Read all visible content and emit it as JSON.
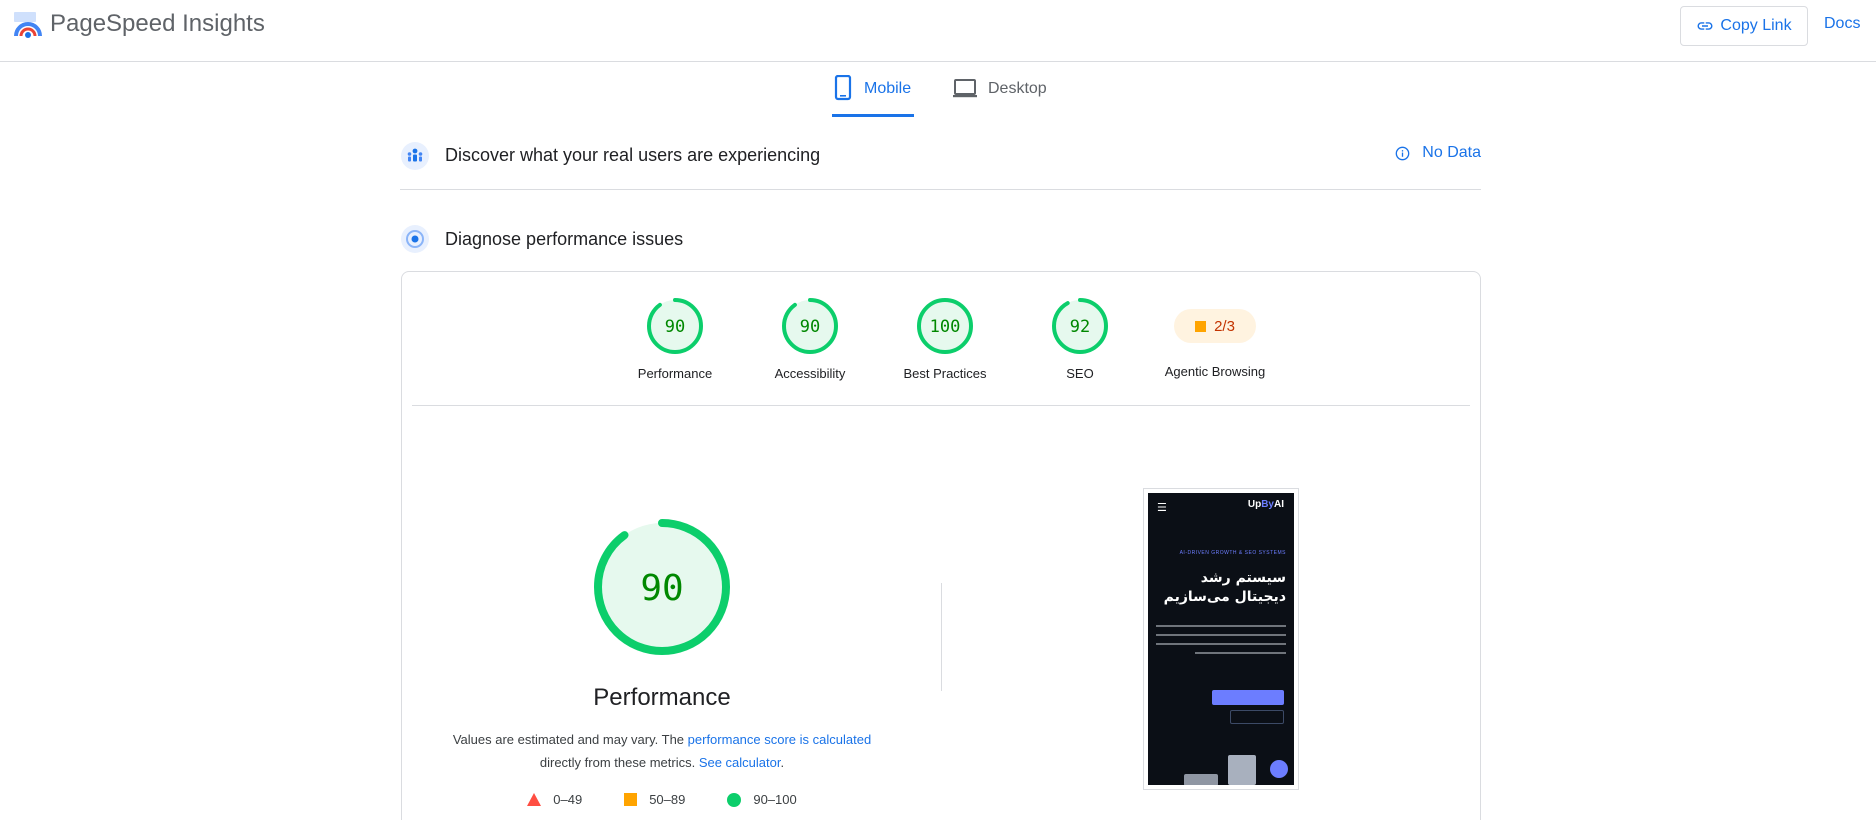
{
  "header": {
    "app_title": "PageSpeed Insights",
    "copy_link_label": "Copy Link",
    "docs_label": "Docs"
  },
  "tabs": [
    {
      "label": "Mobile",
      "selected": true
    },
    {
      "label": "Desktop",
      "selected": false
    }
  ],
  "field_section": {
    "title": "Discover what your real users are experiencing",
    "status": "No Data"
  },
  "lab_section": {
    "title": "Diagnose performance issues"
  },
  "scores": [
    {
      "label": "Performance",
      "value": "90",
      "fraction": 0.9
    },
    {
      "label": "Accessibility",
      "value": "90",
      "fraction": 0.9
    },
    {
      "label": "Best Practices",
      "value": "100",
      "fraction": 1.0
    },
    {
      "label": "SEO",
      "value": "92",
      "fraction": 0.92
    }
  ],
  "agentic": {
    "label": "Agentic Browsing",
    "value": "2/3"
  },
  "main_score": {
    "value": "90",
    "fraction": 0.9,
    "title": "Performance",
    "note_prefix": "Values are estimated and may vary. The ",
    "note_link1": "performance score is calculated",
    "note_mid": "directly from these metrics. ",
    "note_link2": "See calculator",
    "note_suffix": "."
  },
  "legend": [
    {
      "label": "0–49"
    },
    {
      "label": "50–89"
    },
    {
      "label": "90–100"
    }
  ],
  "thumbnail": {
    "brand_prefix": "Up",
    "brand_mid": "By",
    "brand_suffix": "AI",
    "kicker": "AI-DRIVEN GROWTH & SEO SYSTEMS",
    "headline": "سیستم رشد دیجیتال می‌سازیم"
  },
  "colors": {
    "pass": "#0cce6b",
    "pass_text": "#008800",
    "pass_bg": "#e6f9ee",
    "average": "#ffa400",
    "fail": "#ff4e42",
    "accent": "#1a73e8"
  }
}
